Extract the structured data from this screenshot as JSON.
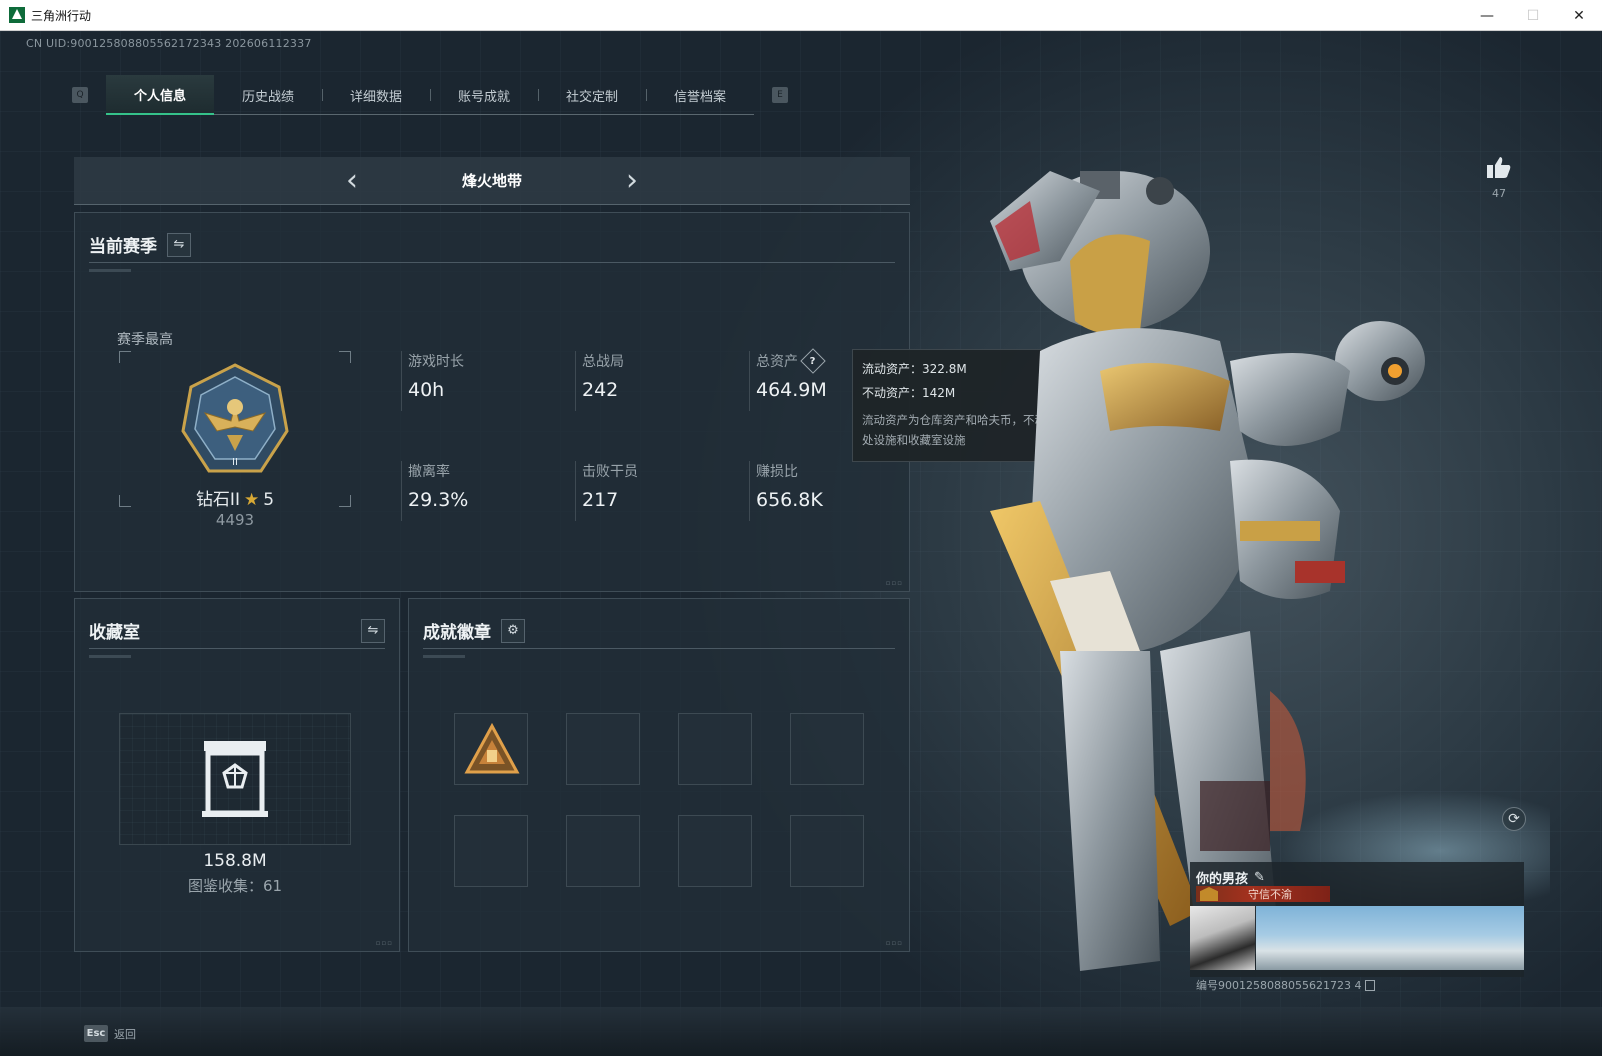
{
  "window": {
    "title": "三角洲行动",
    "minimize": "—",
    "maximize": "☐",
    "close": "✕"
  },
  "uid_text": "CN UID:900125808805562172343 202606112337",
  "tabs": {
    "prev_key": "Q",
    "next_key": "E",
    "items": [
      {
        "label": "个人信息",
        "active": true
      },
      {
        "label": "历史战绩",
        "active": false
      },
      {
        "label": "详细数据",
        "active": false
      },
      {
        "label": "账号成就",
        "active": false
      },
      {
        "label": "社交定制",
        "active": false
      },
      {
        "label": "信誉档案",
        "active": false
      }
    ]
  },
  "mode_selector": {
    "label": "烽火地带"
  },
  "season": {
    "title": "当前赛季",
    "best_label": "赛季最高",
    "rank_name": "钻石II",
    "rank_stars": "5",
    "rank_score": "4493",
    "stats": [
      {
        "label": "游戏时长",
        "value": "40h"
      },
      {
        "label": "总战局",
        "value": "242"
      },
      {
        "label": "总资产",
        "value": "464.9M",
        "help": "?"
      },
      {
        "label": "撤离率",
        "value": "29.3%"
      },
      {
        "label": "击败干员",
        "value": "217"
      },
      {
        "label": "赚损比",
        "value": "656.8K"
      }
    ]
  },
  "tooltip": {
    "liquid": "流动资产：322.8M",
    "fixed": "不动资产：142M",
    "desc": "流动资产为仓库资产和哈夫币，不动资产为特勤处设施和收藏室设施"
  },
  "collection": {
    "title": "收藏室",
    "value": "158.8M",
    "count_text": "图鉴收集：61"
  },
  "achievements": {
    "title": "成就徽章"
  },
  "likes": {
    "count": "47"
  },
  "player": {
    "name": "你的男孩",
    "title_text": "守信不渝",
    "id_text": "编号9001258088055621723 4"
  },
  "bottom": {
    "esc_key": "Esc",
    "esc_label": "返回"
  },
  "colors": {
    "accent": "#35c28a",
    "gold": "#d8a935",
    "title_red": "#a3311e"
  }
}
